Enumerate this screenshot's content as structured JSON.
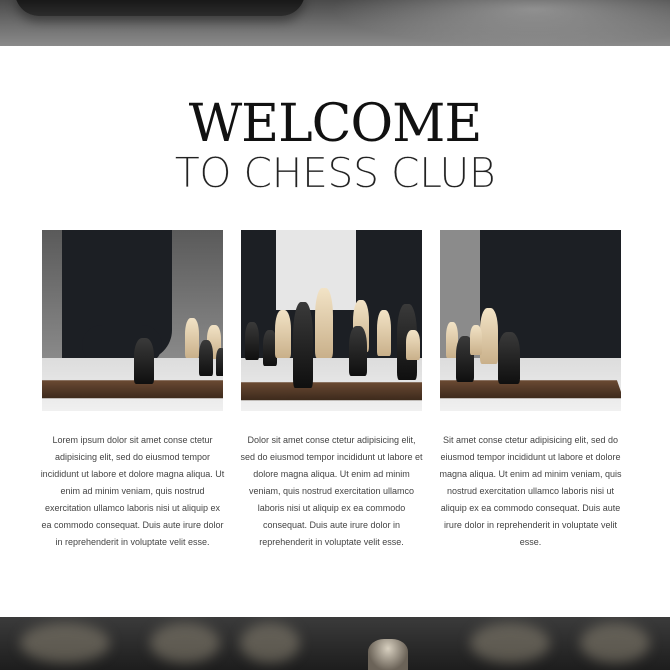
{
  "hero": {
    "title": "WELCOME",
    "subtitle": "TO CHESS CLUB"
  },
  "cards": [
    {
      "text": "Lorem ipsum dolor sit amet conse ctetur adipisicing elit, sed do eiusmod tempor incididunt ut labore et dolore magna aliqua. Ut enim ad minim veniam, quis nostrud exercitation ullamco laboris nisi ut aliquip ex ea commodo consequat. Duis aute irure dolor in reprehenderit in voluptate velit esse."
    },
    {
      "text": "Dolor sit amet conse ctetur adipisicing elit, sed do eiusmod tempor incididunt ut labore et dolore magna aliqua. Ut enim ad minim veniam, quis nostrud exercitation ullamco laboris nisi ut aliquip ex ea commodo consequat. Duis aute irure dolor in reprehenderit in voluptate velit esse."
    },
    {
      "text": "Sit amet conse ctetur adipisicing elit, sed do eiusmod tempor incididunt ut labore et dolore magna aliqua. Ut enim ad minim veniam, quis nostrud exercitation ullamco laboris nisi ut aliquip ex ea commodo consequat. Duis aute irure dolor in reprehenderit in voluptate velit esse."
    }
  ],
  "colors": {
    "background": "#ffffff",
    "title": "#111111",
    "body_text": "#444444"
  }
}
